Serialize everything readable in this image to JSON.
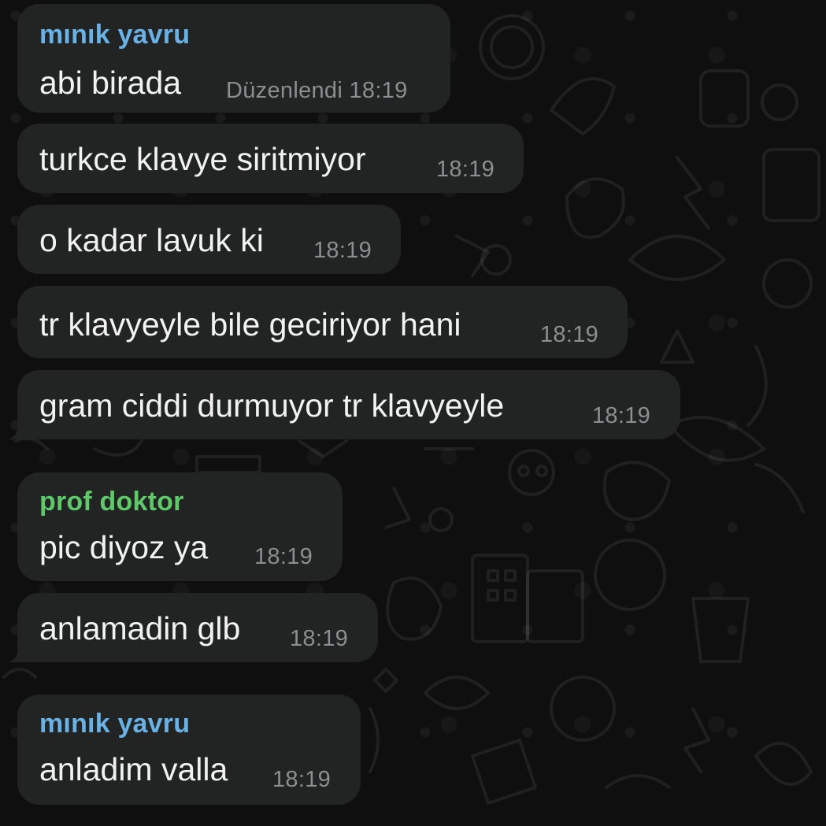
{
  "colors": {
    "background": "#0f0f0f",
    "bubble": "#222323",
    "message_text": "#f2f2f2",
    "timestamp": "#8d8e8f",
    "sender_minik_yavru": "#6ab2e6",
    "sender_prof_doktor": "#5fc96a"
  },
  "messages": [
    {
      "sender": "mınık yavru",
      "text": "abi birada",
      "edited": "Düzenlendi",
      "time": "18:19"
    },
    {
      "text": "turkce klavye siritmiyor",
      "time": "18:19"
    },
    {
      "text": "o kadar lavuk ki",
      "time": "18:19"
    },
    {
      "text": "tr klavyeyle bile geciriyor hani",
      "time": "18:19"
    },
    {
      "text": "gram ciddi durmuyor tr klavyeyle",
      "time": "18:19"
    },
    {
      "sender": "prof doktor",
      "text": "pic diyoz ya",
      "time": "18:19"
    },
    {
      "text": "anlamadin glb",
      "time": "18:19"
    },
    {
      "sender": "mınık yavru",
      "text": "anladim valla",
      "time": "18:19"
    }
  ]
}
